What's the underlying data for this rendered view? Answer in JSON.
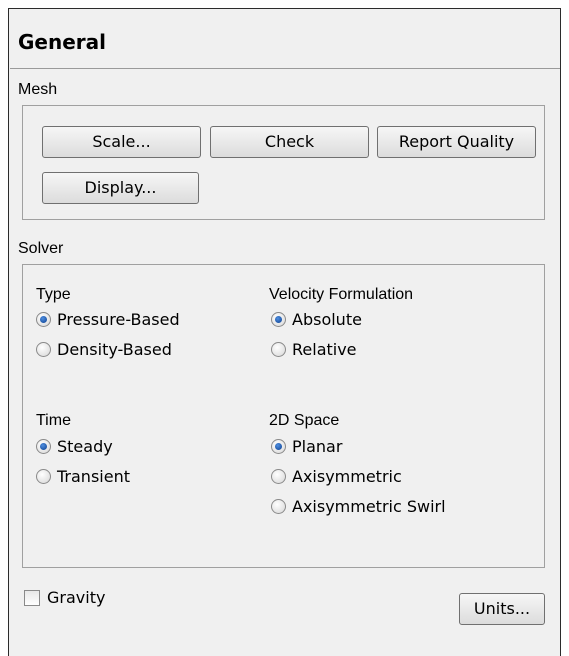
{
  "panel": {
    "title": "General"
  },
  "mesh": {
    "label": "Mesh",
    "buttons": {
      "scale": "Scale...",
      "check": "Check",
      "report_quality": "Report Quality",
      "display": "Display..."
    }
  },
  "solver": {
    "label": "Solver",
    "type": {
      "label": "Type",
      "options": [
        "Pressure-Based",
        "Density-Based"
      ],
      "selected": "Pressure-Based"
    },
    "velocity_formulation": {
      "label": "Velocity Formulation",
      "options": [
        "Absolute",
        "Relative"
      ],
      "selected": "Absolute"
    },
    "time": {
      "label": "Time",
      "options": [
        "Steady",
        "Transient"
      ],
      "selected": "Steady"
    },
    "space_2d": {
      "label": "2D Space",
      "options": [
        "Planar",
        "Axisymmetric",
        "Axisymmetric Swirl"
      ],
      "selected": "Planar"
    }
  },
  "gravity": {
    "label": "Gravity",
    "checked": false
  },
  "units_button": "Units..."
}
